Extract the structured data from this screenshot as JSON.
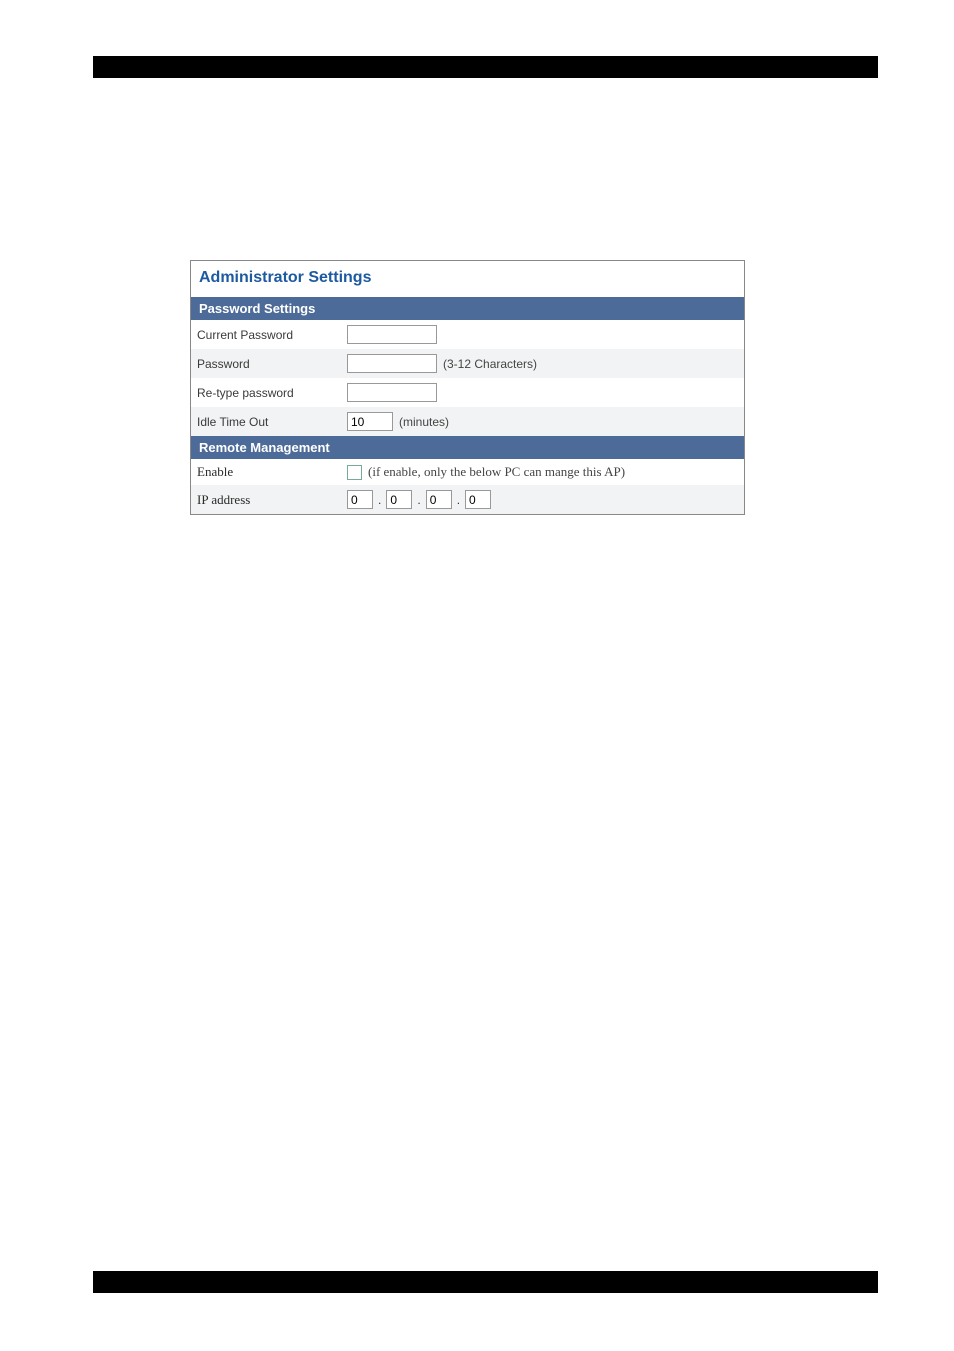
{
  "panel": {
    "title": "Administrator Settings",
    "sections": {
      "password": {
        "header": "Password Settings",
        "current_password_label": "Current Password",
        "current_password_value": "",
        "password_label": "Password",
        "password_value": "",
        "password_hint": "(3-12 Characters)",
        "retype_label": "Re-type password",
        "retype_value": "",
        "idle_label": "Idle Time Out",
        "idle_value": "10",
        "idle_hint": "(minutes)"
      },
      "remote": {
        "header": "Remote Management",
        "enable_label": "Enable",
        "enable_checked": false,
        "enable_hint": "(if enable, only the below PC can mange this AP)",
        "ip_label": "IP address",
        "ip_octets": [
          "0",
          "0",
          "0",
          "0"
        ]
      }
    }
  }
}
